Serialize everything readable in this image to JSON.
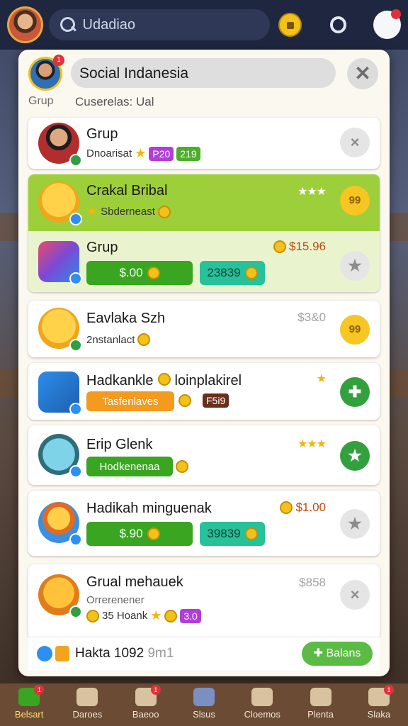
{
  "topbar": {
    "search_text": "Udadiao",
    "icons": [
      "avatar-icon",
      "search-icon",
      "lock-icon",
      "ring-icon",
      "profile-icon"
    ]
  },
  "modal": {
    "title": "Social Indanesia",
    "grup_label": "Grup",
    "subtitle": "Cuserelas: Ual",
    "me_badge": "1"
  },
  "rows": [
    {
      "name": "Grup",
      "meta": "Dnoarisat",
      "pill1": "P20",
      "pill2": "219",
      "action": "×"
    },
    {
      "name": "Crakal Bribal",
      "meta": "Sbderneast",
      "stars": "★★★",
      "action": "99"
    },
    {
      "name": "Grup",
      "price": "$15.96",
      "bar1": "$.00",
      "bar2": "23839",
      "action": "★"
    },
    {
      "name": "Eavlaka Szh",
      "meta": "2nstanlact",
      "price": "$3&0",
      "action": "99"
    },
    {
      "name": "Hadkankle",
      "name2": "loinplakirel",
      "bar1": "Tasfenlaves",
      "pill": "F5i9",
      "action": "✚"
    },
    {
      "name": "Erip Glenk",
      "bar1": "Hodkenenaa",
      "stars": "★★★",
      "action": "★"
    },
    {
      "name": "Hadikah minguenak",
      "price": "$1.00",
      "bar1": "$.90",
      "bar2": "39839",
      "action": "★"
    },
    {
      "name": "Grual mehauek",
      "meta": "Orrerenener",
      "meta2": "35 Hoank",
      "pill": "3.0",
      "price": "$858",
      "action": "×"
    }
  ],
  "footer": {
    "text": "Hakta 1092",
    "muted": "9m1",
    "button": "Balans"
  },
  "bottomnav": [
    {
      "label": "Belsart",
      "badge": "1"
    },
    {
      "label": "Daroes",
      "badge": ""
    },
    {
      "label": "Baeoo",
      "badge": "1"
    },
    {
      "label": "Slsus",
      "badge": ""
    },
    {
      "label": "Cloemos",
      "badge": ""
    },
    {
      "label": "Plenta",
      "badge": ""
    },
    {
      "label": "Slaka",
      "badge": "1"
    }
  ]
}
